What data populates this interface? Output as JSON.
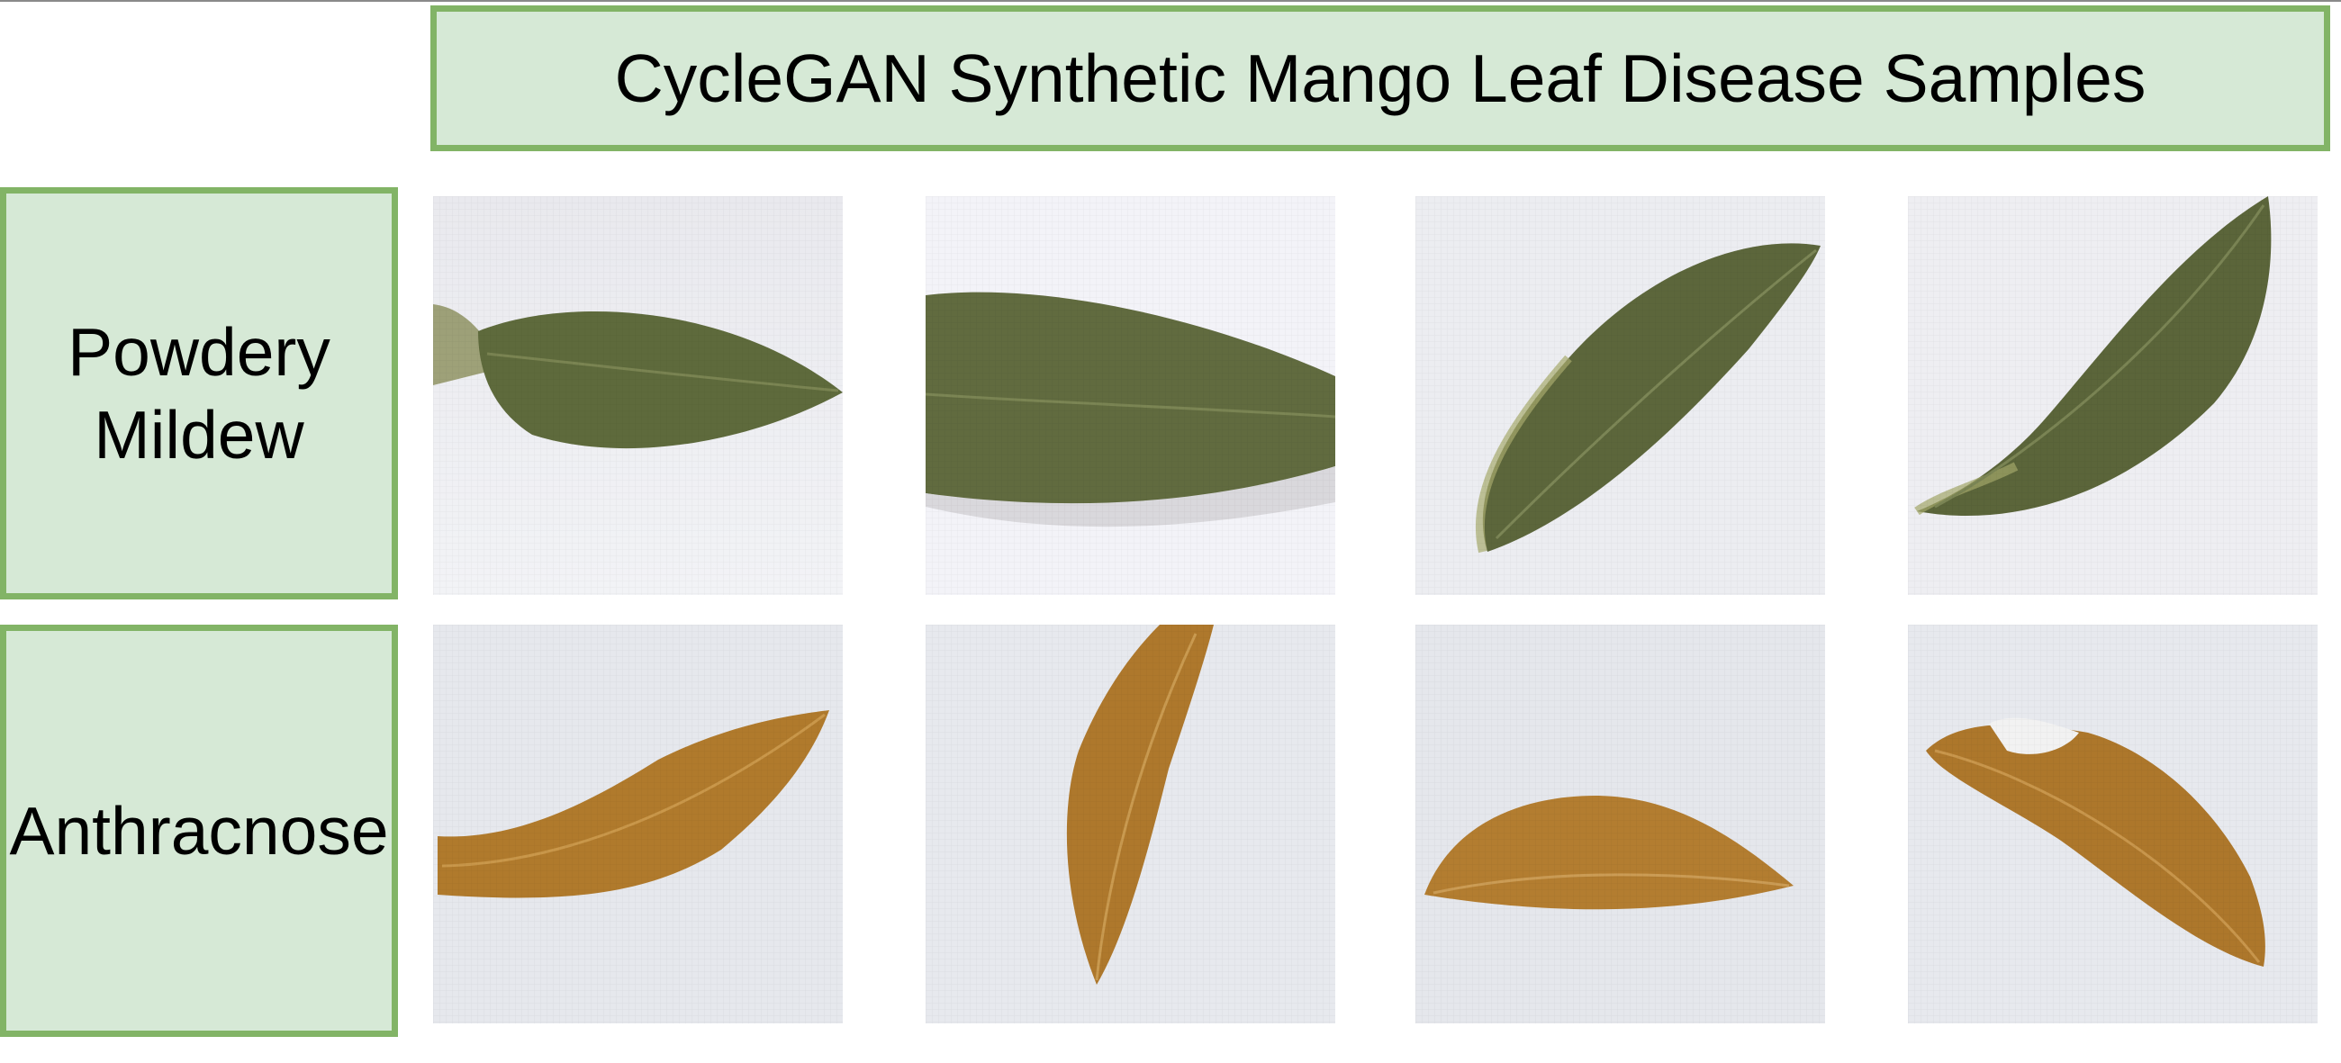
{
  "title": "CycleGAN Synthetic Mango Leaf Disease Samples",
  "rows": [
    {
      "label_line1": "Powdery",
      "label_line2": "Mildew",
      "leaf_color": "#5e6a3c"
    },
    {
      "label": "Anthracnose",
      "leaf_color": "#b07a2c"
    }
  ],
  "colors": {
    "box_fill": "#d6e9d6",
    "box_border": "#82b466"
  }
}
